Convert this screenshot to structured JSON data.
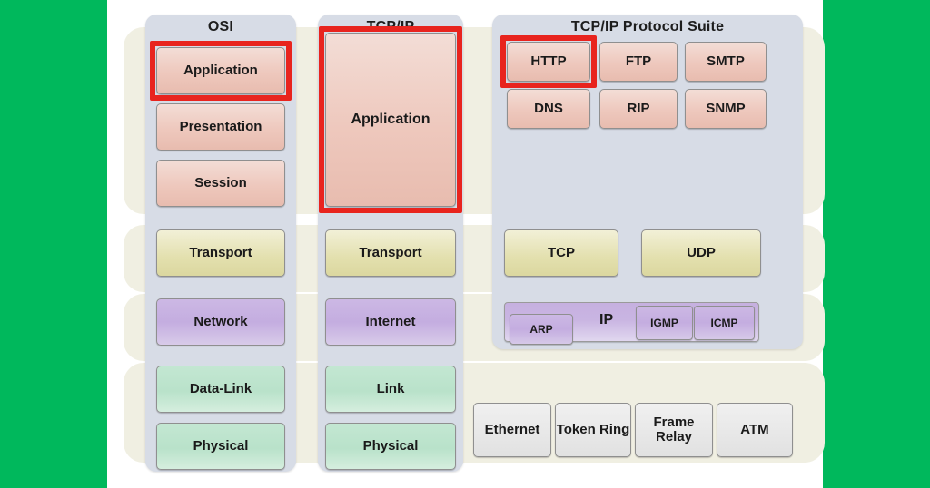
{
  "canvas": {
    "background_color": "#ffffff",
    "page_background_color": "#00b85c"
  },
  "columns": [
    {
      "id": "osi",
      "title": "OSI"
    },
    {
      "id": "tcpip",
      "title": "TCP/IP"
    },
    {
      "id": "suite",
      "title": "TCP/IP Protocol Suite"
    }
  ],
  "osi_layers": [
    {
      "label": "Application",
      "group": "application"
    },
    {
      "label": "Presentation",
      "group": "application"
    },
    {
      "label": "Session",
      "group": "application"
    },
    {
      "label": "Transport",
      "group": "transport"
    },
    {
      "label": "Network",
      "group": "network"
    },
    {
      "label": "Data-Link",
      "group": "link"
    },
    {
      "label": "Physical",
      "group": "link"
    }
  ],
  "tcpip_layers": [
    {
      "label": "Application",
      "group": "application"
    },
    {
      "label": "Transport",
      "group": "transport"
    },
    {
      "label": "Internet",
      "group": "network"
    },
    {
      "label": "Link",
      "group": "link"
    },
    {
      "label": "Physical",
      "group": "link"
    }
  ],
  "protocol_suite": {
    "application": [
      "HTTP",
      "FTP",
      "SMTP",
      "DNS",
      "RIP",
      "SNMP"
    ],
    "transport": [
      "TCP",
      "UDP"
    ],
    "network": {
      "arp": "ARP",
      "ip": "IP",
      "igmp": "IGMP",
      "icmp": "ICMP"
    },
    "link": [
      "Ethernet",
      "Token Ring",
      "Frame Relay",
      "ATM"
    ]
  },
  "highlights": {
    "color": "#e8241e",
    "items": [
      "osi-application",
      "tcpip-application",
      "suite-http"
    ]
  },
  "palette": {
    "band": "#f0efe2",
    "column": "#d7dce6",
    "application_box": "#eec8bd",
    "transport_box": "#e3e0ae",
    "network_box": "#c4ade0",
    "link_box": "#b9e2ca",
    "physical_box": "#e8e8e8",
    "highlight_red": "#e8241e",
    "page_green": "#00b85c"
  }
}
